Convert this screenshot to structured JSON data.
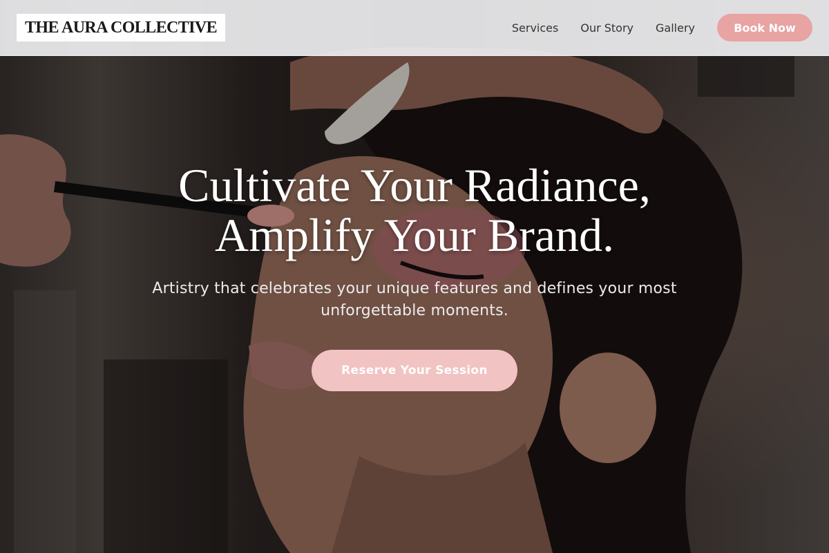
{
  "brand": {
    "name": "THE AURA COLLECTIVE"
  },
  "nav": {
    "links": [
      {
        "label": "Services"
      },
      {
        "label": "Our Story"
      },
      {
        "label": "Gallery"
      }
    ],
    "cta_label": "Book Now"
  },
  "hero": {
    "headline_line1": "Cultivate Your Radiance,",
    "headline_line2": "Amplify Your Brand.",
    "subheadline": "Artistry that celebrates your unique features and defines your most unforgettable moments.",
    "cta_label": "Reserve Your Session",
    "background_image": "makeup-artist-applying-blush-photo"
  },
  "colors": {
    "accent": "#e8a3a3",
    "cta_light": "#f1c3c3",
    "nav_bg": "#ececee",
    "text_light": "#ffffff"
  }
}
